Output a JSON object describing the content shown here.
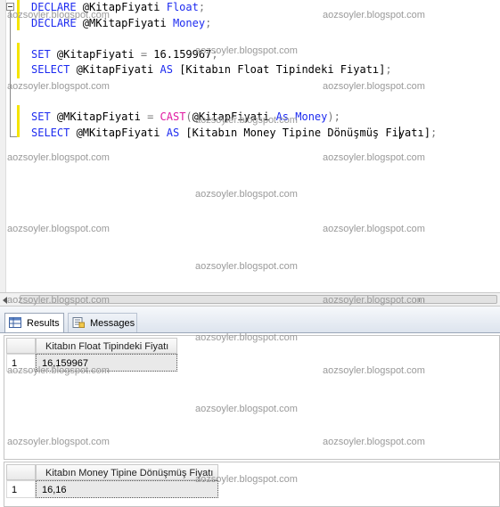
{
  "editor": {
    "line1": {
      "kw": "DECLARE",
      "var": " @KitapFiyati ",
      "type": "Float",
      "end": ";"
    },
    "line2": {
      "kw": "DECLARE",
      "var": " @MKitapFiyati ",
      "type": "Money",
      "end": ";"
    },
    "line3": {
      "kw": "SET",
      "text": " @KitapFiyati ",
      "op": "=",
      "val": " 16.159967",
      "end": ";"
    },
    "line4": {
      "kw": "SELECT",
      "text1": " @KitapFiyati ",
      "kw2": "AS",
      "text2": " [Kitabın Float Tipindeki Fiyatı]",
      "end": ";"
    },
    "line5": {
      "kw": "SET",
      "text1": " @MKitapFiyati ",
      "op": "=",
      "fn": " CAST",
      "paren1": "(",
      "text2": "@KitapFiyati ",
      "kw2": "As",
      "type": " Money",
      "paren2": ")",
      "end": ";"
    },
    "line6": {
      "kw": "SELECT",
      "text1": " @MKitapFiyati ",
      "kw2": "AS",
      "text2": " [Kitabın Money Tipine Dönüşmüş Fiyatı]",
      "end": ";"
    }
  },
  "tabs": {
    "results": "Results",
    "messages": "Messages"
  },
  "grid1": {
    "header": "Kitabın Float Tipindeki Fiyatı",
    "row_number": "1",
    "value": "16,159967"
  },
  "grid2": {
    "header": "Kitabın Money Tipine Dönüşmüş Fiyatı",
    "row_number": "1",
    "value": "16,16"
  },
  "watermark": "aozsoyler.blogspot.com",
  "colors": {
    "keyword": "#1d2bf0",
    "function": "#e01ba2",
    "operator": "#7a7a7a",
    "change_bar": "#f5e400"
  }
}
